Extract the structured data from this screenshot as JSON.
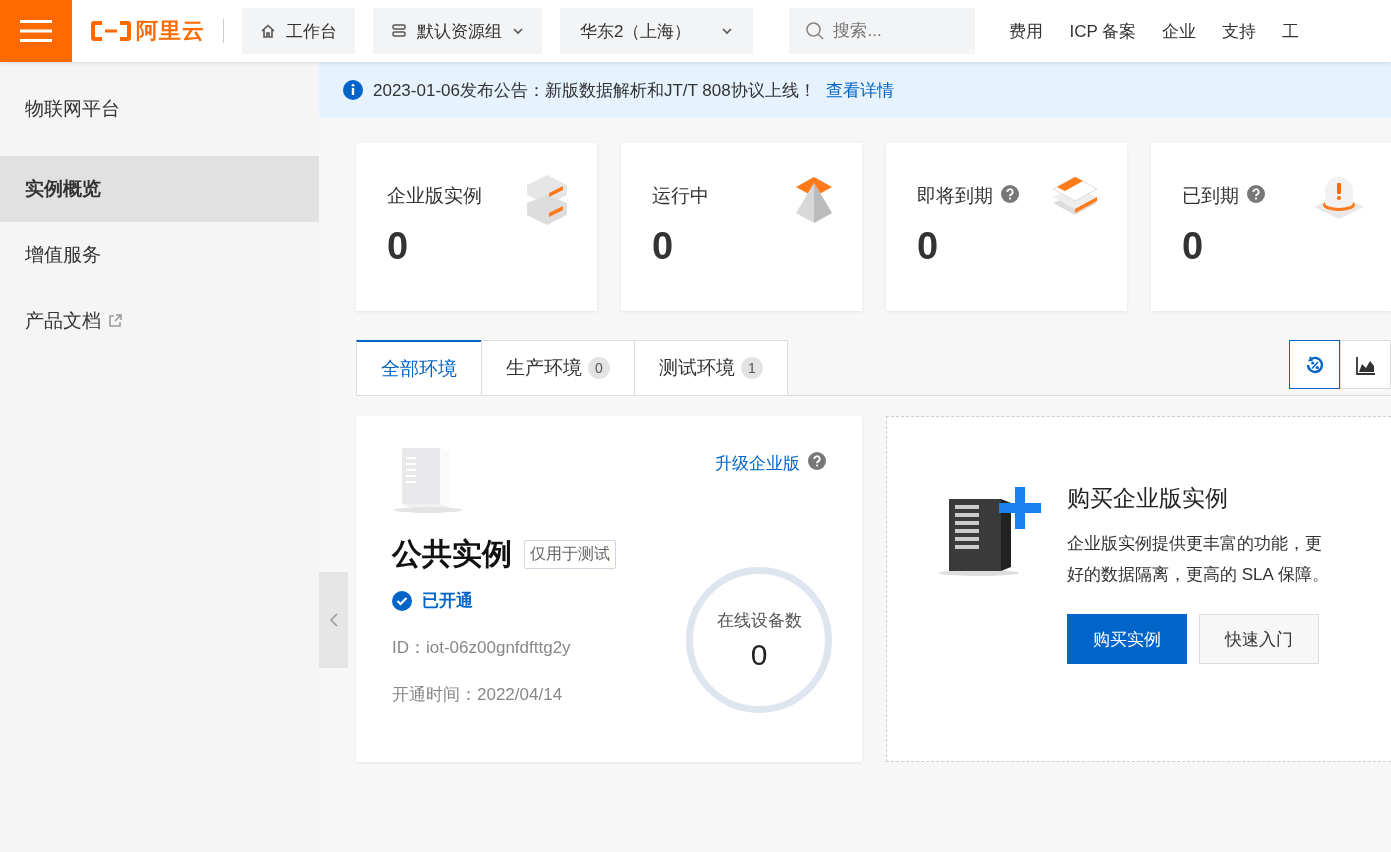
{
  "topbar": {
    "logo": "阿里云",
    "workbench": "工作台",
    "resource_group": "默认资源组",
    "region": "华东2（上海）",
    "search": {
      "placeholder": "搜索..."
    },
    "links": [
      "费用",
      "ICP 备案",
      "企业",
      "支持",
      "工"
    ]
  },
  "sidebar": {
    "title": "物联网平台",
    "items": [
      {
        "label": "实例概览",
        "selected": true,
        "external": false
      },
      {
        "label": "增值服务",
        "selected": false,
        "external": false
      },
      {
        "label": "产品文档",
        "selected": false,
        "external": true
      }
    ]
  },
  "notice": {
    "text": "2023-01-06发布公告：新版数据解析和JT/T 808协议上线！",
    "link": "查看详情"
  },
  "stats": [
    {
      "label": "企业版实例",
      "value": "0",
      "help": false,
      "kind": "stack"
    },
    {
      "label": "运行中",
      "value": "0",
      "help": false,
      "kind": "pyramid"
    },
    {
      "label": "即将到期",
      "value": "0",
      "help": true,
      "kind": "docs"
    },
    {
      "label": "已到期",
      "value": "0",
      "help": true,
      "kind": "alarm"
    }
  ],
  "tabs": [
    {
      "label": "全部环境",
      "selected": true
    },
    {
      "label": "生产环境",
      "count": "0",
      "selected": false
    },
    {
      "label": "测试环境",
      "count": "1",
      "selected": false
    }
  ],
  "view_toggles": [
    {
      "kind": "percent",
      "selected": true
    },
    {
      "kind": "area",
      "selected": false
    }
  ],
  "public_instance": {
    "upgrade_link": "升级企业版",
    "title": "公共实例",
    "tag": "仅用于测试",
    "status": "已开通",
    "id": "ID：iot-06z00gnfdfttg2y",
    "opened": "开通时间：2022/04/14",
    "online_label": "在线设备数",
    "online_count": "0"
  },
  "buy_card": {
    "title": "购买企业版实例",
    "description": "企业版实例提供更丰富的功能，更好的数据隔离，更高的 SLA 保障。",
    "buttons": [
      {
        "label": "购买实例",
        "kind": "primary"
      },
      {
        "label": "快速入门",
        "kind": "default"
      }
    ]
  }
}
